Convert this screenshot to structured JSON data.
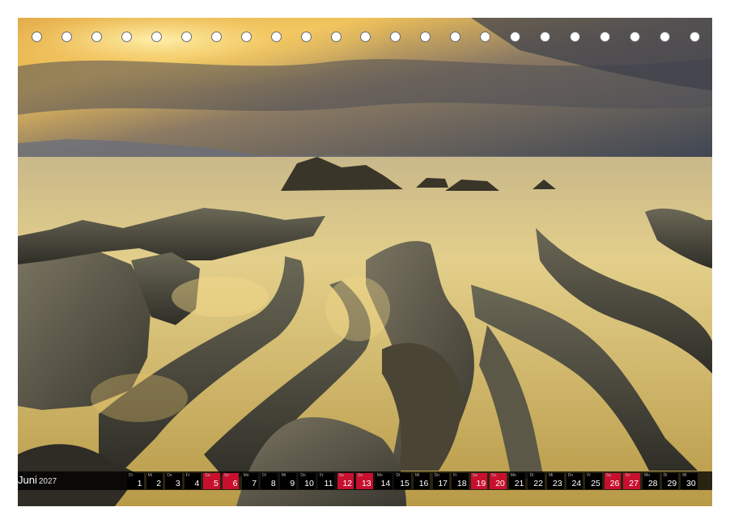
{
  "calendar": {
    "month": "Juni",
    "year": "2027",
    "days": [
      {
        "n": "1",
        "wd": "Di",
        "weekend": false
      },
      {
        "n": "2",
        "wd": "Mi",
        "weekend": false
      },
      {
        "n": "3",
        "wd": "Do",
        "weekend": false
      },
      {
        "n": "4",
        "wd": "Fr",
        "weekend": false
      },
      {
        "n": "5",
        "wd": "Sa",
        "weekend": true
      },
      {
        "n": "6",
        "wd": "So",
        "weekend": true
      },
      {
        "n": "7",
        "wd": "Mo",
        "weekend": false
      },
      {
        "n": "8",
        "wd": "Di",
        "weekend": false
      },
      {
        "n": "9",
        "wd": "Mi",
        "weekend": false
      },
      {
        "n": "10",
        "wd": "Do",
        "weekend": false
      },
      {
        "n": "11",
        "wd": "Fr",
        "weekend": false
      },
      {
        "n": "12",
        "wd": "Sa",
        "weekend": true
      },
      {
        "n": "13",
        "wd": "So",
        "weekend": true
      },
      {
        "n": "14",
        "wd": "Mo",
        "weekend": false
      },
      {
        "n": "15",
        "wd": "Di",
        "weekend": false
      },
      {
        "n": "16",
        "wd": "Mi",
        "weekend": false
      },
      {
        "n": "17",
        "wd": "Do",
        "weekend": false
      },
      {
        "n": "18",
        "wd": "Fr",
        "weekend": false
      },
      {
        "n": "19",
        "wd": "Sa",
        "weekend": true
      },
      {
        "n": "20",
        "wd": "So",
        "weekend": true
      },
      {
        "n": "21",
        "wd": "Mo",
        "weekend": false
      },
      {
        "n": "22",
        "wd": "Di",
        "weekend": false
      },
      {
        "n": "23",
        "wd": "Mi",
        "weekend": false
      },
      {
        "n": "24",
        "wd": "Do",
        "weekend": false
      },
      {
        "n": "25",
        "wd": "Fr",
        "weekend": false
      },
      {
        "n": "26",
        "wd": "Sa",
        "weekend": true
      },
      {
        "n": "27",
        "wd": "So",
        "weekend": true
      },
      {
        "n": "28",
        "wd": "Mo",
        "weekend": false
      },
      {
        "n": "29",
        "wd": "Di",
        "weekend": false
      },
      {
        "n": "30",
        "wd": "Mi",
        "weekend": false
      }
    ]
  },
  "colors": {
    "weekend": "#c8102e",
    "weekday": "#000000"
  }
}
